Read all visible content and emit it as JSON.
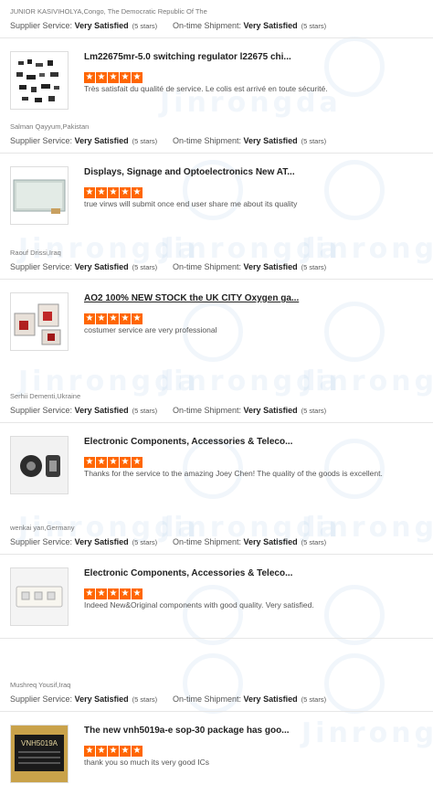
{
  "labels": {
    "supplier_service": "Supplier Service:",
    "on_time_shipment": "On-time Shipment:",
    "star_glyph": "★"
  },
  "watermark": {
    "text": "Jinrongda",
    "logo_letters": "JR"
  },
  "reviews": [
    {
      "reviewer": "JUNIOR KASIVIHOLYA,Congo, The Democratic Republic Of The",
      "supplier_rating": "Very Satisfied",
      "supplier_stars": "(5 stars)",
      "shipment_rating": "Very Satisfied",
      "shipment_stars": "(5 stars)",
      "product_title": "Lm22675mr-5.0 switching regulator l22675 chi...",
      "rating_stars": 5,
      "comment": "Très satisfait du qualité de service. Le colis est arrivé en toute sécurité."
    },
    {
      "reviewer": "Salman Qayyum,Pakistan",
      "supplier_rating": "Very Satisfied",
      "supplier_stars": "(5 stars)",
      "shipment_rating": "Very Satisfied",
      "shipment_stars": "(5 stars)",
      "product_title": "Displays, Signage and Optoelectronics New AT...",
      "rating_stars": 5,
      "comment": "true virws will submit once end user share me about its quality"
    },
    {
      "reviewer": "Raouf Drissi,Iraq",
      "supplier_rating": "Very Satisfied",
      "supplier_stars": "(5 stars)",
      "shipment_rating": "Very Satisfied",
      "shipment_stars": "(5 stars)",
      "product_title": "AO2 100% NEW STOCK the UK CITY Oxygen ga...",
      "rating_stars": 5,
      "comment": "costumer service are very professional"
    },
    {
      "reviewer": "Serhii Dementi,Ukraine",
      "supplier_rating": "Very Satisfied",
      "supplier_stars": "(5 stars)",
      "shipment_rating": "Very Satisfied",
      "shipment_stars": "(5 stars)",
      "product_title": "Electronic Components, Accessories & Teleco...",
      "rating_stars": 5,
      "comment": "Thanks for the service to the amazing Joey Chen! The quality of the goods is excellent."
    },
    {
      "reviewer": "wenkai yan,Germany",
      "supplier_rating": "Very Satisfied",
      "supplier_stars": "(5 stars)",
      "shipment_rating": "Very Satisfied",
      "shipment_stars": "(5 stars)",
      "product_title": "Electronic Components, Accessories & Teleco...",
      "rating_stars": 5,
      "comment": "Indeed New&Original components with good quality. Very satisfied."
    },
    {
      "reviewer": "Mushreq Yousif,Iraq",
      "supplier_rating": "Very Satisfied",
      "supplier_stars": "(5 stars)",
      "shipment_rating": "Very Satisfied",
      "shipment_stars": "(5 stars)",
      "product_title": "The new vnh5019a-e sop-30 package has goo...",
      "rating_stars": 5,
      "comment": "thank you so much its very good ICs",
      "thumb_text": "VNH5019A"
    }
  ]
}
